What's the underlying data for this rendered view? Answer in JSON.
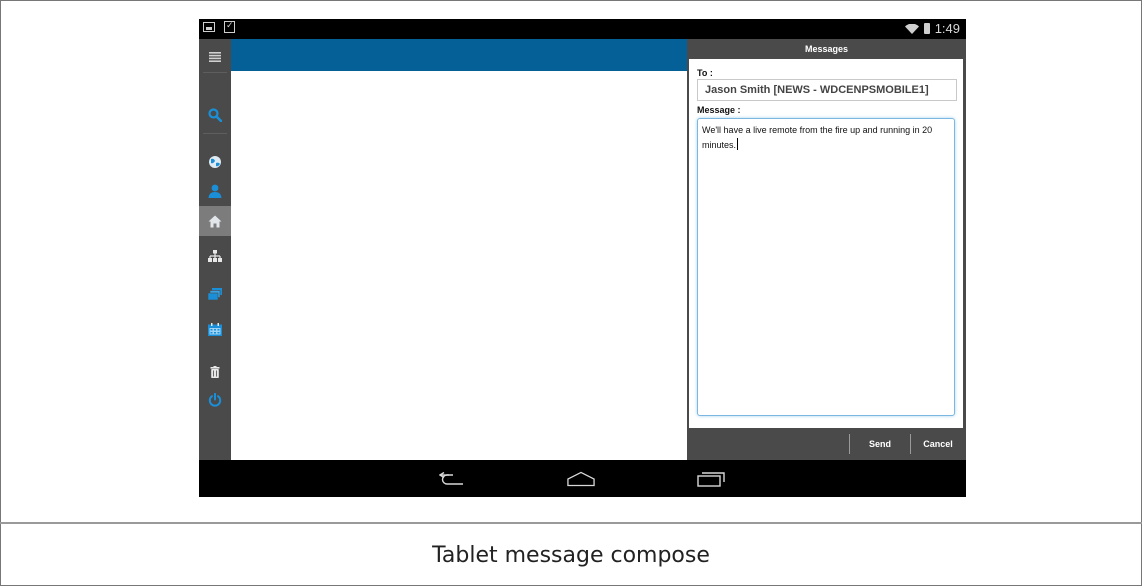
{
  "status_bar": {
    "time": "1:49",
    "icons": [
      "picture-notification-icon",
      "shopping-bag-notification-icon",
      "wifi-icon",
      "battery-icon"
    ]
  },
  "sidebar": {
    "items": [
      {
        "name": "menu-icon",
        "active": false
      },
      {
        "name": "search-icon",
        "active": false
      },
      {
        "name": "globe-icon",
        "active": false
      },
      {
        "name": "person-icon",
        "active": false
      },
      {
        "name": "home-icon",
        "active": true
      },
      {
        "name": "hierarchy-icon",
        "active": false
      },
      {
        "name": "stack-icon",
        "active": false
      },
      {
        "name": "calendar-icon",
        "active": false
      },
      {
        "name": "trash-icon",
        "active": false
      },
      {
        "name": "power-icon",
        "active": false
      }
    ]
  },
  "messages_panel": {
    "title": "Messages",
    "to_label": "To :",
    "to_value": "Jason Smith [NEWS - WDCENPSMOBILE1]",
    "message_label": "Message :",
    "message_text": "We'll have a live remote from the fire up and running in 20 minutes.",
    "send_label": "Send",
    "cancel_label": "Cancel"
  },
  "nav_bar": {
    "buttons": [
      "back-icon",
      "home-nav-icon",
      "recent-apps-icon"
    ]
  },
  "caption": "Tablet message compose",
  "colors": {
    "header_blue": "#046097",
    "accent_blue": "#1a8fd8",
    "sidebar_gray": "#4a4a4a",
    "active_item_gray": "#7c7c7c"
  }
}
